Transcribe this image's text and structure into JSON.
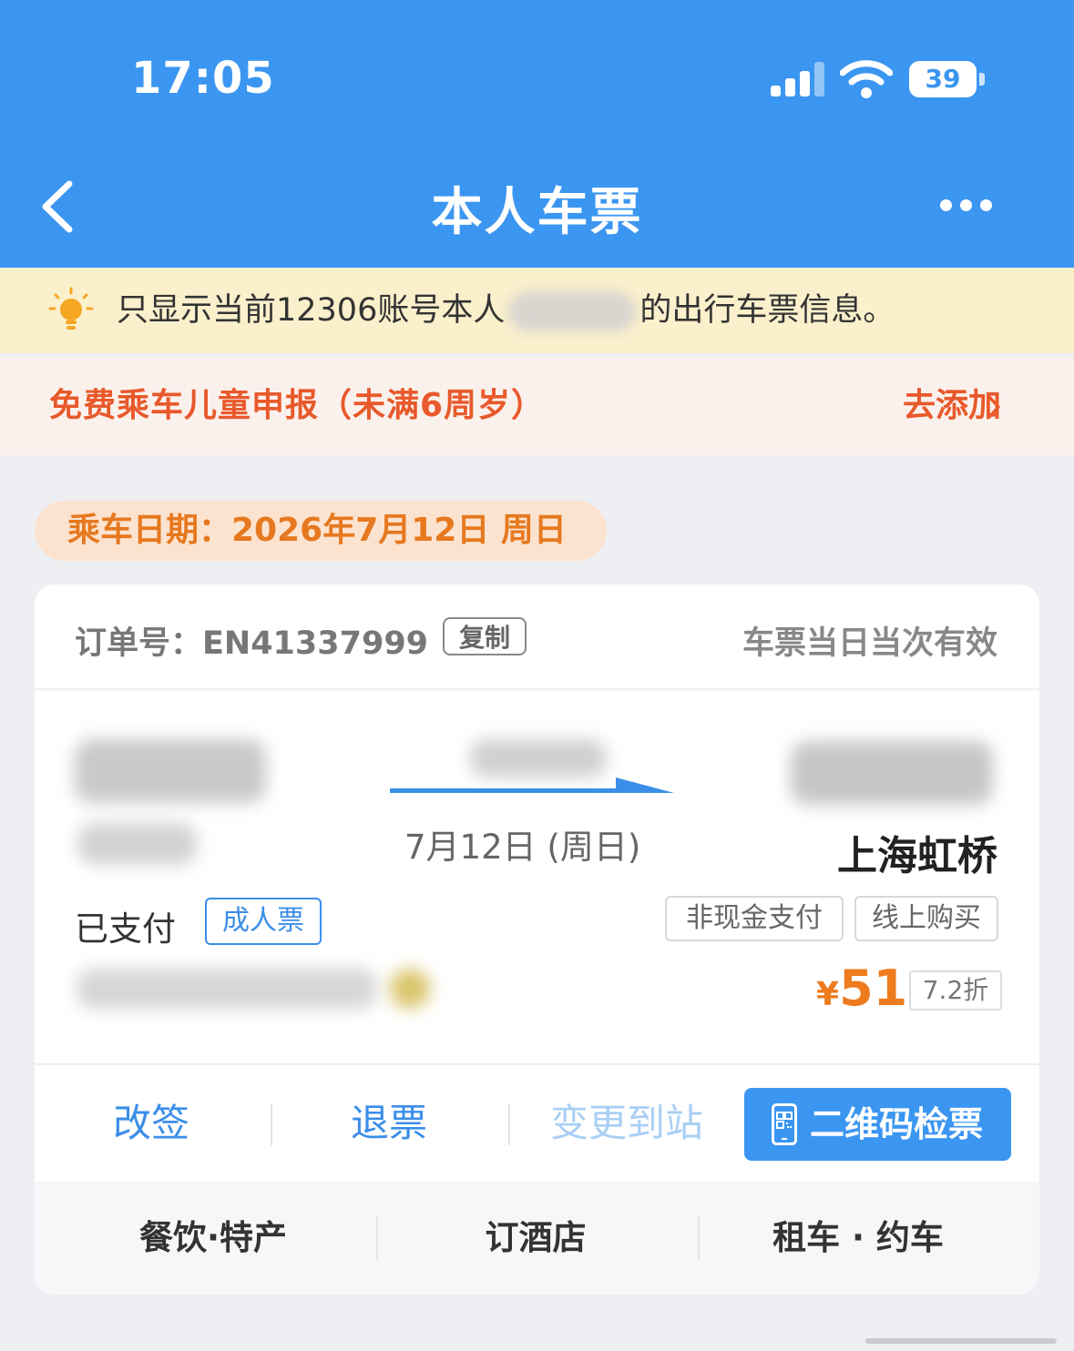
{
  "status_bar": {
    "time": "17:05",
    "battery": "39"
  },
  "nav": {
    "title": "本人车票"
  },
  "notice": {
    "text_before": "只显示当前12306账号本人",
    "text_after": "的出行车票信息。"
  },
  "child_banner": {
    "text": "免费乘车儿童申报（未满6周岁）",
    "link": "去添加"
  },
  "travel_date": {
    "label": "乘车日期：2026年7月12日 周日"
  },
  "ticket": {
    "order_label": "订单号：EN41337999",
    "copy_label": "复制",
    "validity": "车票当日当次有效",
    "date": "7月12日 (周日)",
    "arrive_station": "上海虹桥",
    "paid_status": "已支付",
    "ticket_type": "成人票",
    "tags": [
      "非现金支付",
      "线上购买"
    ],
    "currency": "¥",
    "price": "51",
    "discount": "7.2折"
  },
  "actions": {
    "change": "改签",
    "refund": "退票",
    "change_station": "变更到站",
    "qr_check": "二维码检票"
  },
  "footer": {
    "food": "餐饮·特产",
    "hotel": "订酒店",
    "car": "租车 · 约车"
  },
  "colors": {
    "brand_blue": "#3b96f1",
    "warning_orange": "#e8592b",
    "price_orange": "#ee7b1e"
  }
}
